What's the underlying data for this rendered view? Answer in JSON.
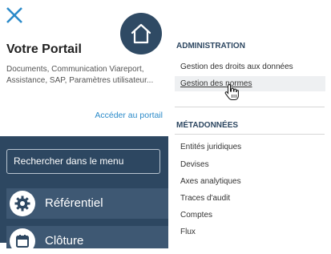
{
  "portal": {
    "title": "Votre Portail",
    "description": "Documents, Communication Viareport, Assistance, SAP, Paramètres utilisateur...",
    "link": "Accéder au portail"
  },
  "search": {
    "label": "Rechercher dans le menu"
  },
  "menu": {
    "items": [
      {
        "label": "Référentiel",
        "icon": "gear-icon"
      },
      {
        "label": "Clôture",
        "icon": "calendar-icon"
      }
    ]
  },
  "administration": {
    "heading": "ADMINISTRATION",
    "items": [
      {
        "label": "Gestion des droits aux données"
      },
      {
        "label": "Gestion des normes"
      }
    ]
  },
  "metadonnees": {
    "heading": "MÉTADONNÉES",
    "items": [
      {
        "label": "Entités juridiques"
      },
      {
        "label": "Devises"
      },
      {
        "label": "Axes analytiques"
      },
      {
        "label": "Traces d'audit"
      },
      {
        "label": "Comptes"
      },
      {
        "label": "Flux"
      }
    ]
  },
  "colors": {
    "accent": "#2a8ac9",
    "dark": "#2d4761",
    "close": "#2a8ac9"
  }
}
